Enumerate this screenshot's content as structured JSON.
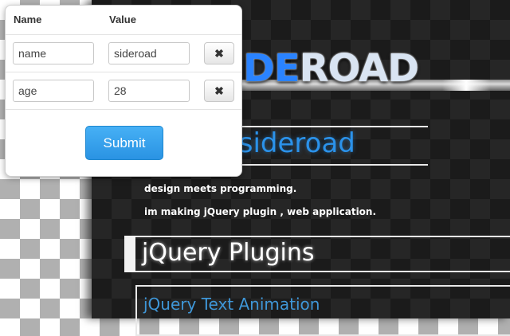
{
  "popup": {
    "headers": {
      "name": "Name",
      "value": "Value"
    },
    "rows": [
      {
        "name": "name",
        "value": "sideroad",
        "delete_icon": "✖"
      },
      {
        "name": "age",
        "value": "28",
        "delete_icon": "✖"
      }
    ],
    "submit_label": "Submit",
    "colors": {
      "submit": "#2a93e3"
    }
  },
  "site": {
    "logo_text_a": "DE",
    "logo_text_b": "ROAD",
    "hero_text": "on the sideroad",
    "tagline_1": "design meets programming.",
    "tagline_2": "im making jQuery plugin , web application.",
    "section_title": "jQuery Plugins",
    "plugin_title": "jQuery Text Animation",
    "colors": {
      "accent": "#2b92ea",
      "background": "#1b1b1b"
    }
  }
}
